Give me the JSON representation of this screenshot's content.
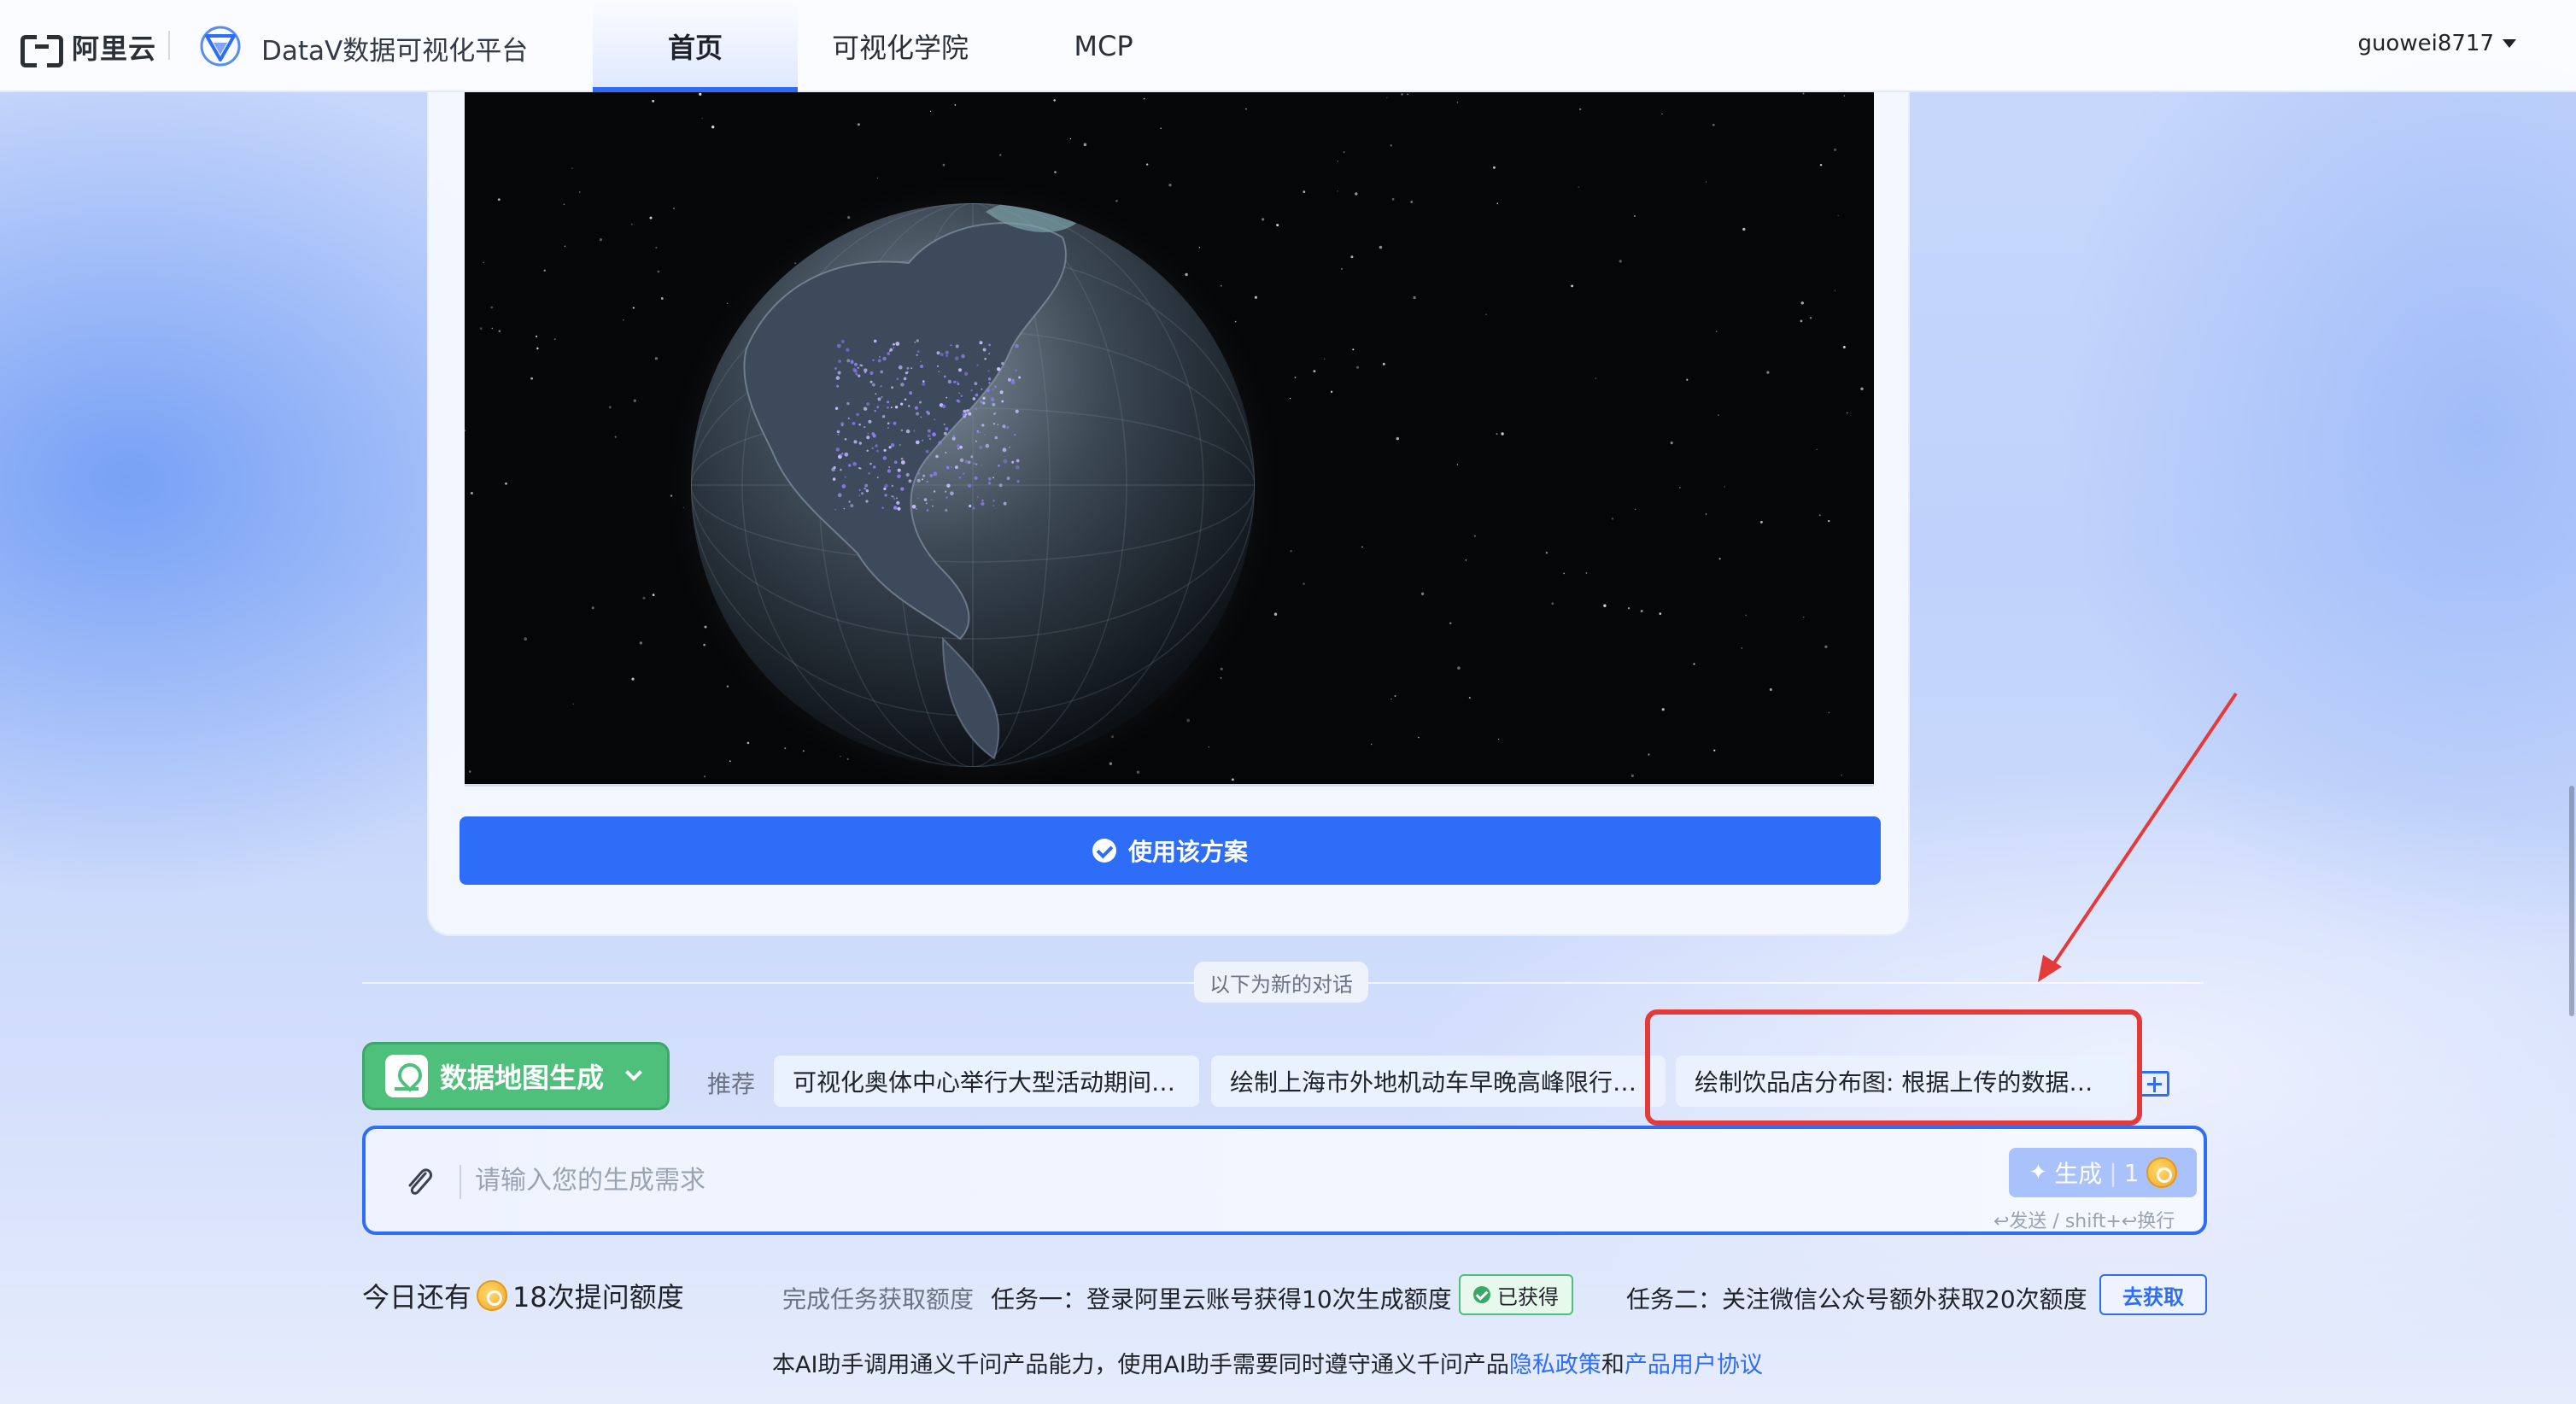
{
  "header": {
    "brand_text": "阿里云",
    "product_title": "DataV数据可视化平台",
    "tabs": [
      {
        "label": "首页",
        "active": true
      },
      {
        "label": "可视化学院",
        "active": false
      },
      {
        "label": "MCP",
        "active": false
      }
    ],
    "username": "guowei8717"
  },
  "result_card": {
    "use_button_label": "使用该方案"
  },
  "divider_label": "以下为新的对话",
  "mode": {
    "label": "数据地图生成",
    "icon": "map-pin-icon"
  },
  "recommend": {
    "label": "推荐",
    "items": [
      "可视化奥体中心举行大型活动期间…",
      "绘制上海市外地机动车早晚高峰限行…",
      "绘制饮品店分布图: 根据上传的数据…"
    ]
  },
  "input": {
    "placeholder": "请输入您的生成需求",
    "generate_label": "生成",
    "generate_cost": "1",
    "hint": "↩发送 / shift+↩换行"
  },
  "quota": {
    "prefix": "今日还有",
    "suffix": "18次提问额度",
    "task_label": "完成任务获取额度",
    "task1": "任务一：登录阿里云账号获得10次生成额度",
    "task1_status": "已获得",
    "task2": "任务二：关注微信公众号额外获取20次额度",
    "task2_button": "去获取"
  },
  "footer": {
    "text": "本AI助手调用通义千问产品能力，使用AI助手需要同时遵守通义千问产品",
    "privacy_link": "隐私政策",
    "and": "和",
    "agreement_link": "产品用户协议"
  },
  "colors": {
    "accent": "#2d6df7",
    "mode_green": "#4fc07c",
    "highlight_red": "#e43a3a"
  }
}
